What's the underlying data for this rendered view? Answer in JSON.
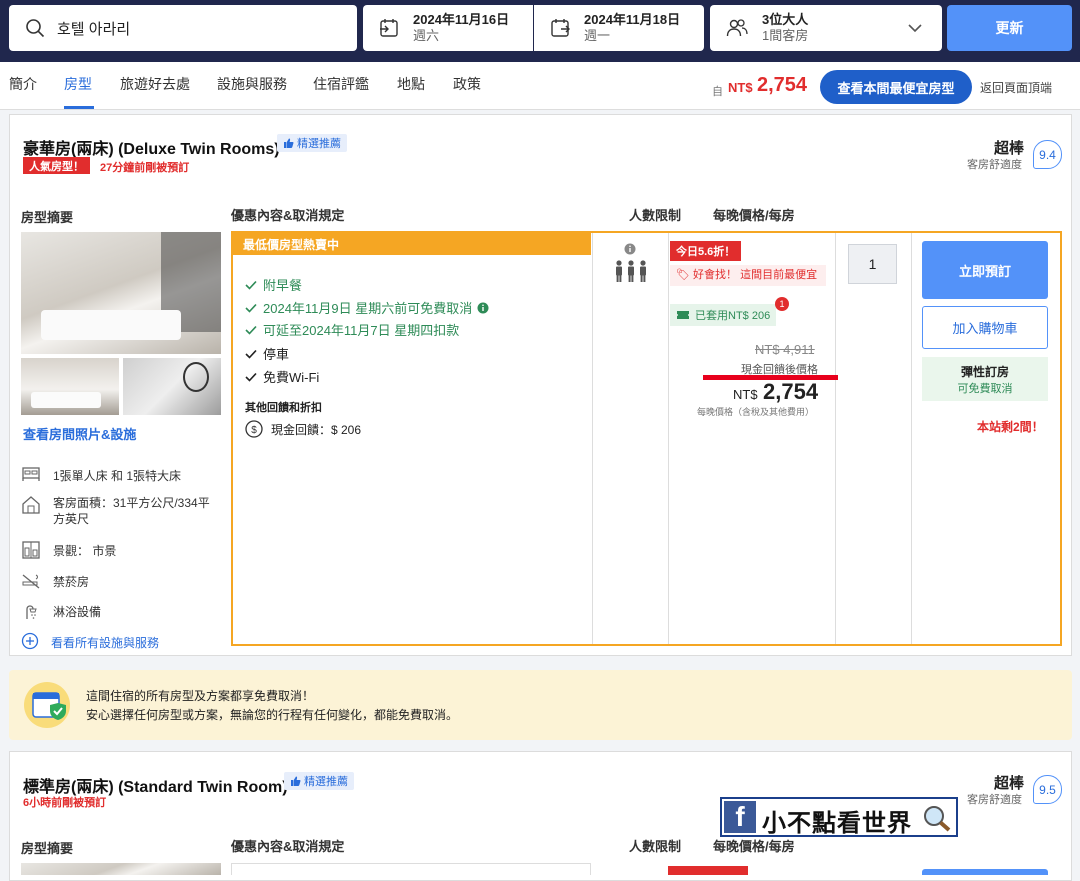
{
  "search": {
    "query": "호텔 아라리",
    "checkin_date": "2024年11月16日",
    "checkin_day": "週六",
    "checkout_date": "2024年11月18日",
    "checkout_day": "週一",
    "guests": "3位大人",
    "rooms": "1間客房",
    "update_label": "更新"
  },
  "nav": {
    "tabs": [
      "簡介",
      "房型",
      "旅遊好去處",
      "設施與服務",
      "住宿評鑑",
      "地點",
      "政策"
    ],
    "active_tab": "房型",
    "price_label": "自",
    "price_currency": "NT$",
    "price": "2,754",
    "cheapest_button": "查看本間最便宜房型",
    "back_to_top": "返回頁面頂端"
  },
  "room1": {
    "title": "豪華房(兩床) (Deluxe Twin Rooms)",
    "recommend_badge": "精選推薦",
    "popular_badge": "人氣房型！",
    "booked_recently": "27分鐘前剛被預訂",
    "score_word": "超棒",
    "score_sub": "客房舒適度",
    "score": "9.4",
    "summary_header": "房型摘要",
    "offers_header": "優惠內容&取消規定",
    "occupancy_header": "人數限制",
    "price_header": "每晚價格/每房",
    "view_photos": "查看房間照片&設施",
    "amenities": [
      "1張單人床 和 1張特大床",
      "客房面積：31平方公尺/334平方英尺",
      "景觀： 市景",
      "禁菸房",
      "淋浴設備"
    ],
    "see_all": "看看所有設施與服務",
    "deal_head": "最低價房型熱賣中",
    "green_features": [
      "附早餐",
      "2024年11月9日 星期六前可免費取消",
      "可延至2024年11月7日 星期四扣款"
    ],
    "black_features": [
      "停車",
      "免費Wi-Fi"
    ],
    "rewards_title": "其他回饋和折扣",
    "cashback": "現金回饋：$ 206",
    "discount_tag": "今日5.6折！",
    "good_find": "好會找！ 這間目前最便宜",
    "coupon": "已套用NT$ 206",
    "coupon_count": "1",
    "original_price": "NT$ 4,911",
    "after_cashback": "現金回饋後價格",
    "final_currency": "NT$",
    "final_price": "2,754",
    "price_note": "每晚價格（含稅及其他費用）",
    "quantity": "1",
    "book_now": "立即預訂",
    "add_cart": "加入購物車",
    "flexible_title": "彈性訂房",
    "flexible_sub": "可免費取消",
    "rooms_left": "本站剩2間！"
  },
  "banner": {
    "line1": "這間住宿的所有房型及方案都享免費取消！",
    "line2": "安心選擇任何房型或方案，無論您的行程有任何變化，都能免費取消。"
  },
  "room2": {
    "title": "標準房(兩床) (Standard Twin Room)",
    "recommend_badge": "精選推薦",
    "booked_recently": "6小時前剛被預訂",
    "score_word": "超棒",
    "score_sub": "客房舒適度",
    "score": "9.5",
    "summary_header": "房型摘要",
    "offers_header": "優惠內容&取消規定",
    "occupancy_header": "人數限制",
    "price_header": "每晚價格/每房"
  },
  "watermark": {
    "text": "小不點看世界"
  },
  "colors": {
    "header_bg": "#20274d",
    "accent_blue": "#5392f9",
    "deal_orange": "#f5a623",
    "price_red": "#e12d2d",
    "green": "#2e8b57"
  }
}
